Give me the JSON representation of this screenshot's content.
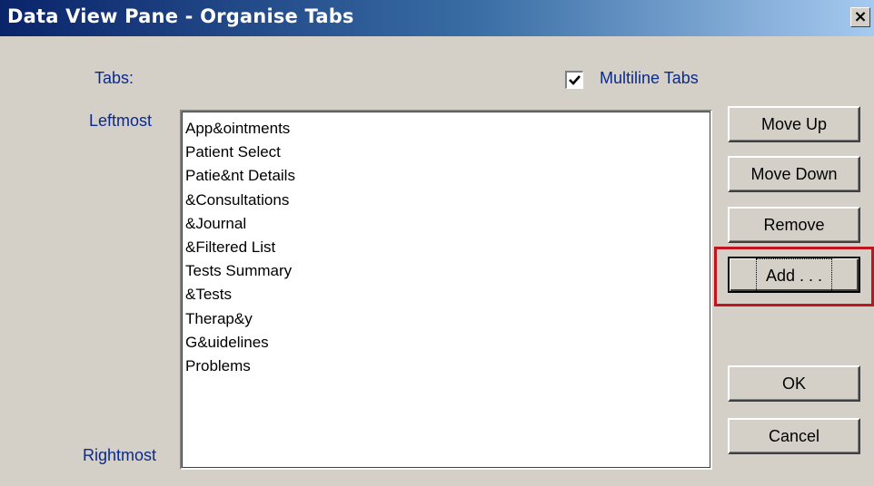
{
  "window": {
    "title": "Data View Pane - Organise Tabs",
    "close_label": "×"
  },
  "labels": {
    "tabs": "Tabs:",
    "leftmost": "Leftmost",
    "rightmost": "Rightmost"
  },
  "multiline": {
    "label": "Multiline Tabs",
    "checked": true
  },
  "tabs_list": [
    "App&ointments",
    "Patient Select",
    "Patie&nt Details",
    "&Consultations",
    "&Journal",
    "&Filtered List",
    "Tests Summary",
    "&Tests",
    "Therap&y",
    "G&uidelines",
    "Problems"
  ],
  "buttons": {
    "move_up": "Move Up",
    "move_down": "Move Down",
    "remove": "Remove",
    "add": "Add . . .",
    "ok": "OK",
    "cancel": "Cancel"
  },
  "highlight_color": "#c0141e"
}
